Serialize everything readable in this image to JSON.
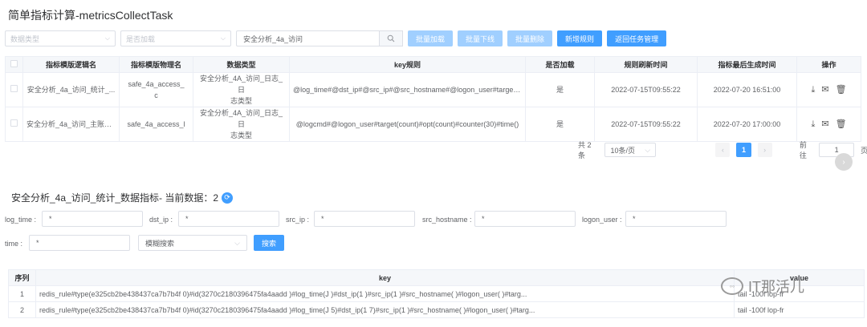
{
  "page_title": "简单指标计算-metricsCollectTask",
  "toolbar": {
    "data_type_placeholder": "数据类型",
    "is_loaded_placeholder": "是否加载",
    "search_value": "安全分析_4a_访问",
    "batch_load": "批量加载",
    "batch_offline": "批量下线",
    "batch_delete": "批量删除",
    "add_rule": "新增规则",
    "back_task": "返回任务管理"
  },
  "table1": {
    "headers": [
      "指标模版逻辑名",
      "指标模版物理名",
      "数据类型",
      "key规则",
      "是否加载",
      "规则刷新时间",
      "指标最后生成时间",
      "操作"
    ],
    "rows": [
      {
        "logic": "安全分析_4a_访问_统计_...",
        "phys1": "safe_4a_access_",
        "phys2": "c",
        "dtype1": "安全分析_4A_访问_日志_日",
        "dtype2": "志类型",
        "key": "@log_time#@dst_ip#@src_ip#@src_hostname#@logon_user#target(l...",
        "loaded": "是",
        "refresh": "2022-07-15T09:55:22",
        "last": "2022-07-20 16:51:00"
      },
      {
        "logic": "安全分析_4a_访问_主账号...",
        "phys1": "safe_4a_access_l",
        "phys2": "",
        "dtype1": "安全分析_4A_访问_日志_日",
        "dtype2": "志类型",
        "key": "@logcmd#@logon_user#target(count)#opt(count)#counter(30)#time()",
        "loaded": "是",
        "refresh": "2022-07-15T09:55:22",
        "last": "2022-07-20 17:00:00"
      }
    ]
  },
  "pager": {
    "total": "共 2 条",
    "page_size": "10条/页",
    "current": "1",
    "goto_label": "前往",
    "goto_value": "1",
    "page_unit": "页"
  },
  "section2": {
    "title": "安全分析_4a_访问_统计_数据指标- 当前数据：2",
    "filters": {
      "log_time_label": "log_time :",
      "dst_ip_label": "dst_ip :",
      "src_ip_label": "src_ip :",
      "src_hostname_label": "src_hostname :",
      "logon_user_label": "logon_user :",
      "time_label": "time :",
      "star": "*",
      "fuzzy_search": "模糊搜索",
      "search_btn": "搜索"
    }
  },
  "table2": {
    "headers": [
      "序列",
      "key",
      "value"
    ],
    "rows": [
      {
        "idx": "1",
        "key": "redis_rule#type(e325cb2be438437ca7b7b4f      0)#id(3270c2180396475fa4aadd    )#log_time(J     )#dst_ip(1      )#src_ip(1     )#src_hostname(      )#logon_user(     )#targ...",
        "value": "tail -100f lop-fr"
      },
      {
        "idx": "2",
        "key": "redis_rule#type(e325cb2be438437ca7b7b4f      0)#id(3270c2180396475fa4aadd    )#log_time(J     5)#dst_ip(1     7)#src_ip(1     )#src_hostname(      )#logon_user(     )#targ...",
        "value": "tail -100f lop-fr"
      }
    ]
  },
  "watermark": "IT那活儿"
}
